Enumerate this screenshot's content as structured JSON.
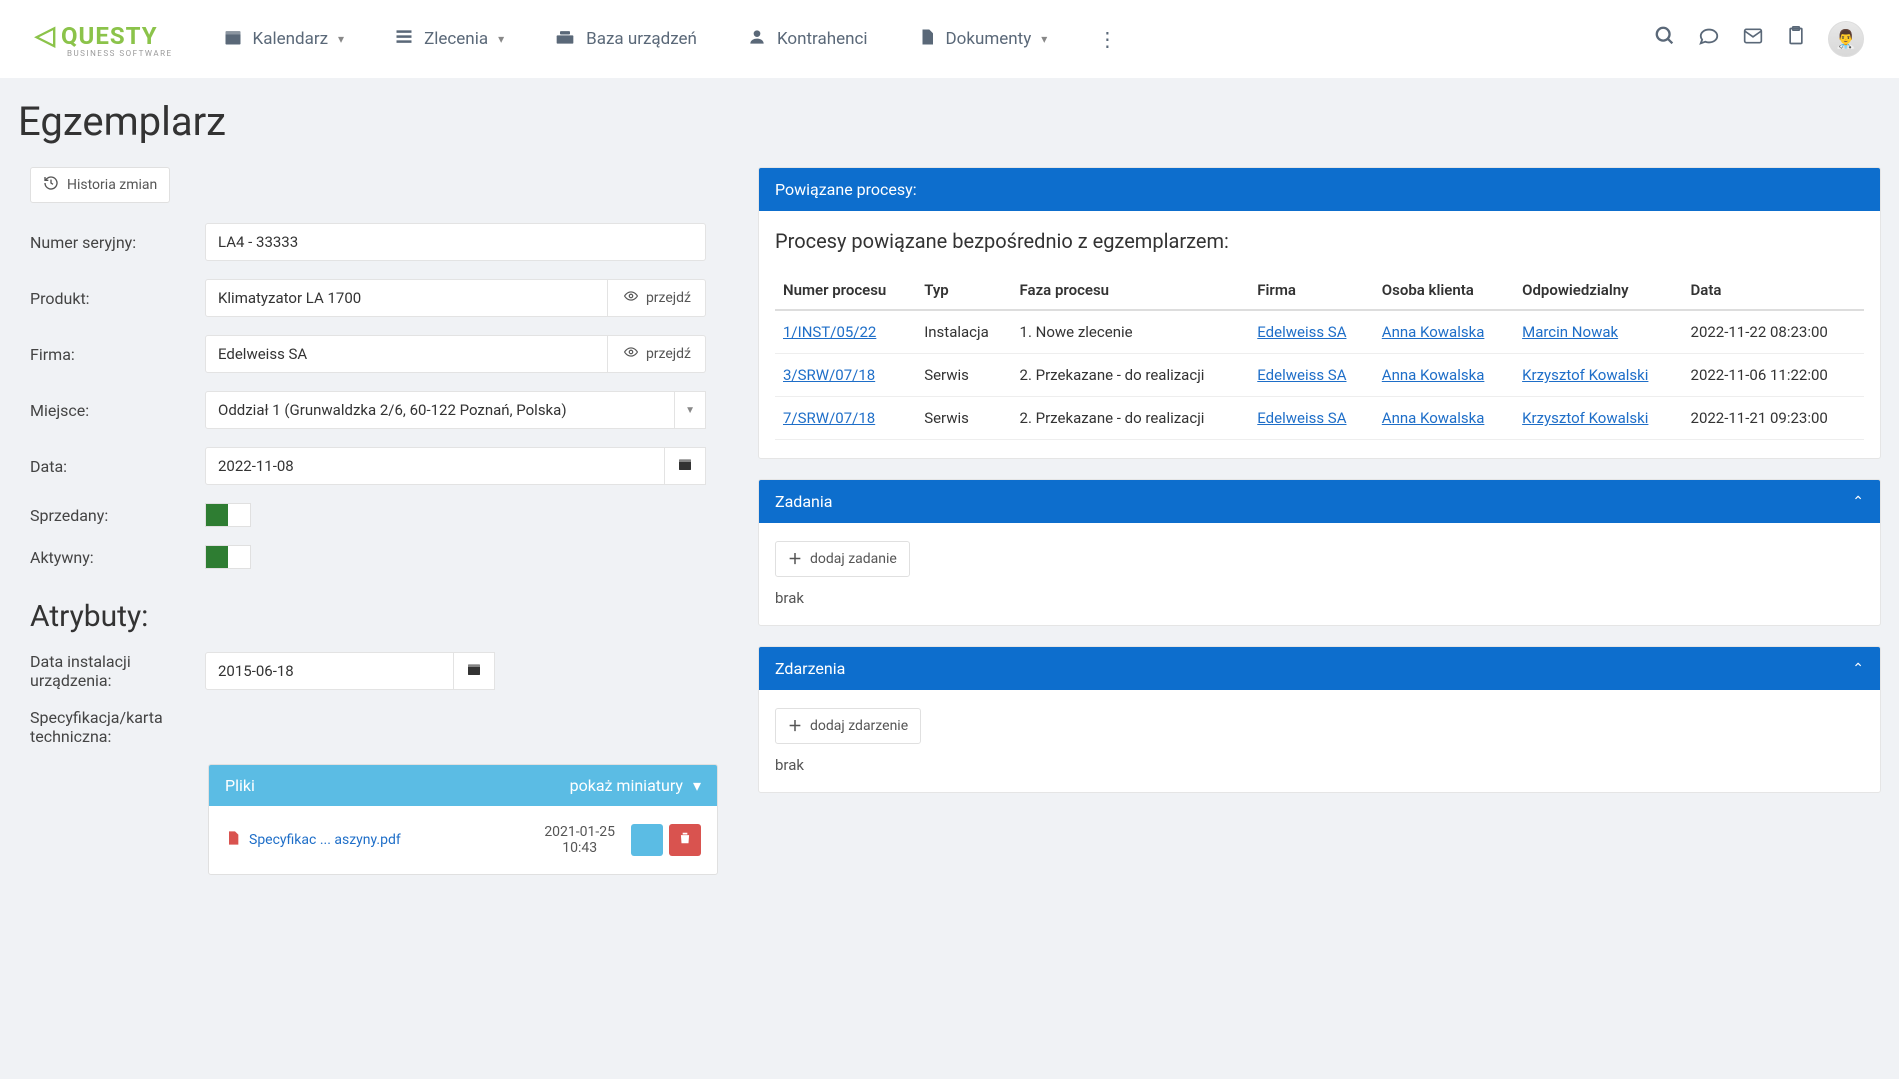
{
  "nav": {
    "kalendarz": "Kalendarz",
    "zlecenia": "Zlecenia",
    "baza": "Baza urządzeń",
    "kontrahenci": "Kontrahenci",
    "dokumenty": "Dokumenty"
  },
  "page": {
    "title": "Egzemplarz"
  },
  "history_btn": "Historia zmian",
  "form": {
    "serial_label": "Numer seryjny:",
    "serial_value": "LA4 - 33333",
    "product_label": "Produkt:",
    "product_value": "Klimatyzator LA 1700",
    "go_to": "przejdź",
    "company_label": "Firma:",
    "company_value": "Edelweiss SA",
    "place_label": "Miejsce:",
    "place_value": "Oddział 1 (Grunwaldzka 2/6, 60-122 Poznań, Polska)",
    "date_label": "Data:",
    "date_value": "2022-11-08",
    "sold_label": "Sprzedany:",
    "active_label": "Aktywny:"
  },
  "attributes": {
    "title": "Atrybuty:",
    "install_label": "Data instalacji urządzenia:",
    "install_value": "2015-06-18",
    "spec_label": "Specyfikacja/karta techniczna:"
  },
  "files": {
    "header": "Pliki",
    "show_thumbs": "pokaż miniatury",
    "file_name": "Specyfikac ... aszyny.pdf",
    "file_date": "2021-01-25",
    "file_time": "10:43"
  },
  "processes": {
    "header": "Powiązane procesy:",
    "subtitle": "Procesy powiązane bezpośrednio z egzemplarzem:",
    "th": {
      "num": "Numer procesu",
      "type": "Typ",
      "phase": "Faza procesu",
      "company": "Firma",
      "client": "Osoba klienta",
      "responsible": "Odpowiedzialny",
      "date": "Data"
    },
    "rows": [
      {
        "num": "1/INST/05/22",
        "type": "Instalacja",
        "phase": "1. Nowe zlecenie",
        "company": "Edelweiss SA",
        "client": "Anna Kowalska",
        "responsible": "Marcin Nowak",
        "date": "2022-11-22 08:23:00"
      },
      {
        "num": "3/SRW/07/18",
        "type": "Serwis",
        "phase": "2. Przekazane - do realizacji",
        "company": "Edelweiss SA",
        "client": "Anna Kowalska",
        "responsible": "Krzysztof Kowalski",
        "date": "2022-11-06 11:22:00"
      },
      {
        "num": "7/SRW/07/18",
        "type": "Serwis",
        "phase": "2. Przekazane - do realizacji",
        "company": "Edelweiss SA",
        "client": "Anna Kowalska",
        "responsible": "Krzysztof Kowalski",
        "date": "2022-11-21 09:23:00"
      }
    ]
  },
  "tasks": {
    "header": "Zadania",
    "add": "dodaj zadanie",
    "none": "brak"
  },
  "events": {
    "header": "Zdarzenia",
    "add": "dodaj zdarzenie",
    "none": "brak"
  }
}
